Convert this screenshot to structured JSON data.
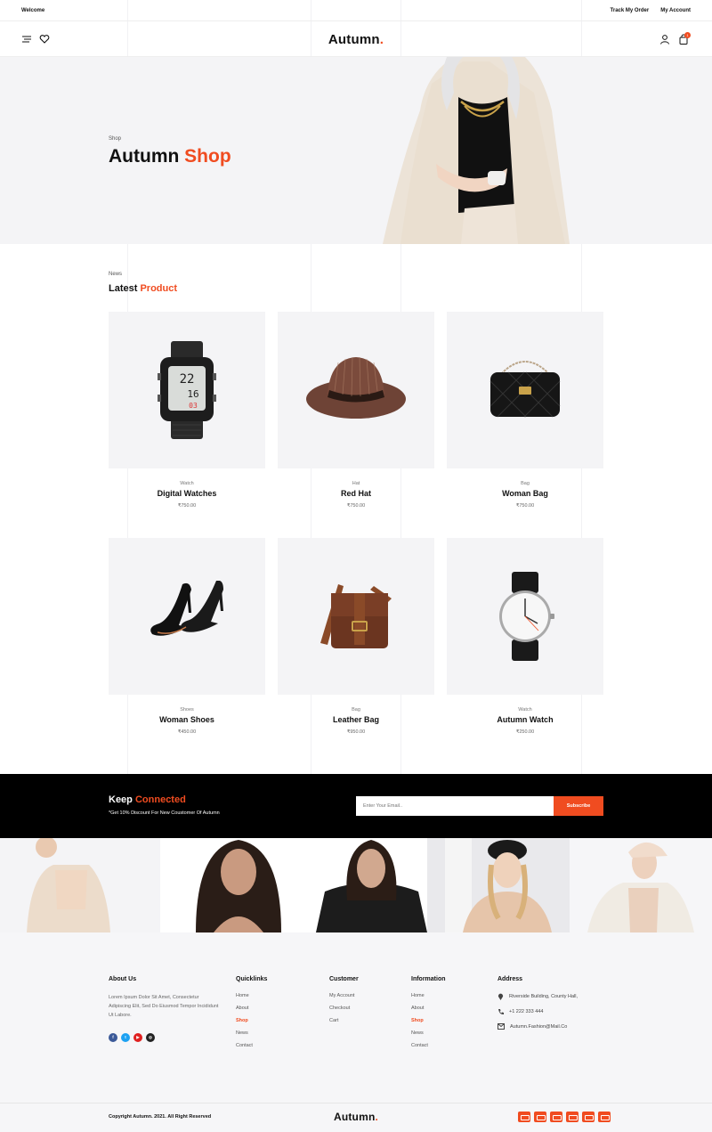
{
  "topbar": {
    "welcome": "Welcome",
    "track_order": "Track My Order",
    "account": "My Account"
  },
  "header": {
    "logo_text": "Autumn",
    "logo_dot": ".",
    "cart_count": "1"
  },
  "hero": {
    "breadcrumb": "Shop",
    "title_plain": "Autumn",
    "title_accent": "Shop"
  },
  "latest": {
    "crumb": "News",
    "title_plain": "Latest",
    "title_accent": "Product",
    "products": [
      {
        "category": "Watch",
        "name": "Digital Watches",
        "price": "₹750.00"
      },
      {
        "category": "Hat",
        "name": "Red Hat",
        "price": "₹750.00"
      },
      {
        "category": "Bag",
        "name": "Woman Bag",
        "price": "₹750.00"
      },
      {
        "category": "Shoes",
        "name": "Woman Shoes",
        "price": "₹450.00"
      },
      {
        "category": "Bag",
        "name": "Leather Bag",
        "price": "₹950.00"
      },
      {
        "category": "Watch",
        "name": "Autumn Watch",
        "price": "₹250.00"
      }
    ]
  },
  "newsletter": {
    "title_plain": "Keep",
    "title_accent": "Connected",
    "subtitle": "*Get 10% Discount For New Coustomer Of Autumn",
    "placeholder": "Enter Your Email..",
    "button": "Subscribe"
  },
  "footer": {
    "about_title": "About Us",
    "about_text": "Lorem Ipsum Dolor Sit Amet, Consectetur Adipiscing Elit, Sed Do Eiusmod Tempor Incididunt Ut Labore.",
    "quicklinks_title": "Quicklinks",
    "quicklinks": [
      "Home",
      "About",
      "Shop",
      "News",
      "Contact"
    ],
    "customer_title": "Customer",
    "customer_links": [
      "My Account",
      "Checkout",
      "Cart"
    ],
    "information_title": "Information",
    "information_links": [
      "Home",
      "About",
      "Shop",
      "News",
      "Contact"
    ],
    "address_title": "Address",
    "address": "Riverside Building, County Hall,",
    "phone": "+1 222 333 444",
    "email": "Autumn.Fashion@Mail.Co",
    "copyright": "Copyright Autumn. 2021. All Right Reserved",
    "social_colors": [
      "#3b5998",
      "#1da1f2",
      "#e02020",
      "#222222"
    ]
  },
  "colors": {
    "accent": "#f04c20"
  }
}
